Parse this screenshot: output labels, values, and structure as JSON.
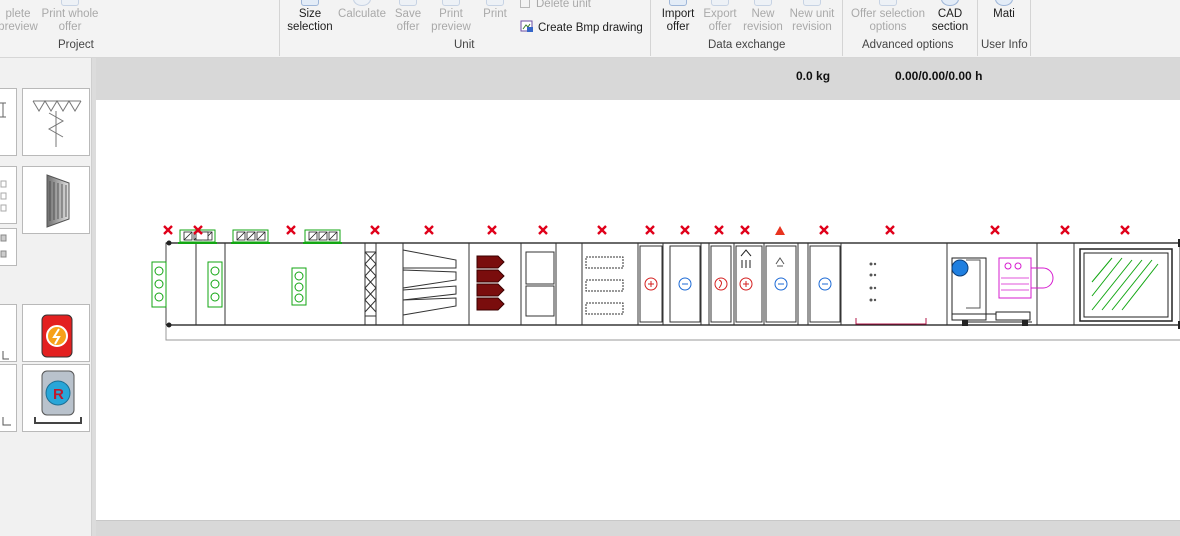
{
  "ribbon": {
    "project": {
      "group_label": "Project",
      "complete_preview": {
        "line1": "plete",
        "line2": "preview"
      },
      "print_whole_offer": {
        "line1": "Print whole",
        "line2": "offer"
      }
    },
    "unit": {
      "group_label": "Unit",
      "size_selection": {
        "line1": "Size",
        "line2": "selection"
      },
      "calculate": {
        "line1": "Calculate"
      },
      "save_offer": {
        "line1": "Save",
        "line2": "offer"
      },
      "print_preview": {
        "line1": "Print",
        "line2": "preview"
      },
      "print": {
        "line1": "Print"
      },
      "delete_unit": "Delete unit",
      "create_bmp_drawing": "Create Bmp drawing"
    },
    "data_exchange": {
      "group_label": "Data exchange",
      "import_offer": {
        "line1": "Import",
        "line2": "offer"
      },
      "export_offer": {
        "line1": "Export",
        "line2": "offer"
      },
      "new_revision": {
        "line1": "New",
        "line2": "revision"
      },
      "new_unit_revision": {
        "line1": "New unit",
        "line2": "revision"
      }
    },
    "advanced_options": {
      "group_label": "Advanced options",
      "offer_selection_options": {
        "line1": "Offer selection",
        "line2": "options"
      },
      "cad_section": {
        "line1": "CAD",
        "line2": "section"
      }
    },
    "user_info": {
      "group_label": "User Info",
      "user": {
        "line1": "Mati"
      }
    }
  },
  "info_bar": {
    "weight": "0.0 kg",
    "hours": "0.00/0.00/0.00 h"
  },
  "palette": {
    "tiles": [
      {
        "icon": "mixing-box-icon"
      },
      {
        "icon": "damper-filter-icon"
      },
      {
        "icon": "coil-icon"
      },
      {
        "icon": "heat-recovery-wheel-icon"
      },
      {
        "icon": "frost-protection-icon"
      },
      {
        "icon": "fire-damper-icon"
      },
      {
        "icon": "sensor-icon"
      },
      {
        "icon": "rotor-r-icon"
      }
    ]
  },
  "drawing": {
    "sections_count_marks": 21,
    "error_marker_color": "#e0001a",
    "warning_marker_color": "#e8331f",
    "damper_color": "#12a612",
    "filter_bag_color": "#7a0d0d",
    "motor_color": "#d61ccf",
    "fan_accent_color": "#1f7fe0",
    "heater_symbol_color": "#d42020",
    "cooler_symbol_color": "#1c6ad6"
  }
}
